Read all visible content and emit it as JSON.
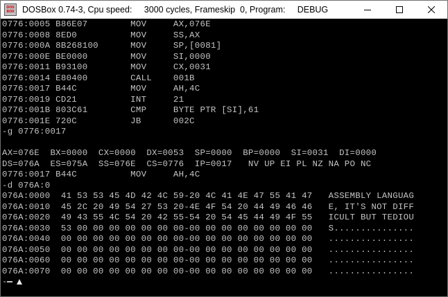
{
  "window": {
    "title": "DOSBox 0.74-3, Cpu speed:     3000 cycles, Frameskip  0, Program:     DEBUG",
    "icon_top": "DOS",
    "icon_bottom": "BOX",
    "buttons": {
      "minimize": "minimize-icon",
      "maximize": "maximize-icon",
      "close": "close-icon"
    }
  },
  "console": {
    "lines": [
      "0776:0005 B86E07        MOV     AX,076E",
      "0776:0008 8ED0          MOV     SS,AX",
      "0776:000A 8B268100      MOV     SP,[0081]",
      "0776:000E BE0000        MOV     SI,0000",
      "0776:0011 B93100        MOV     CX,0031",
      "0776:0014 E80400        CALL    001B",
      "0776:0017 B44C          MOV     AH,4C",
      "0776:0019 CD21          INT     21",
      "0776:001B 803C61        CMP     BYTE PTR [SI],61",
      "0776:001E 720C          JB      002C",
      "-g 0776:0017",
      "",
      "AX=076E  BX=0000  CX=0000  DX=0053  SP=0000  BP=0000  SI=0031  DI=0000",
      "DS=076A  ES=075A  SS=076E  CS=0776  IP=0017   NV UP EI PL NZ NA PO NC",
      "0776:0017 B44C          MOV     AH,4C",
      "-d 076A:0",
      "076A:0000  41 53 53 45 4D 42 4C 59-20 4C 41 4E 47 55 41 47   ASSEMBLY LANGUAG",
      "076A:0010  45 2C 20 49 54 27 53 20-4E 4F 54 20 44 49 46 46   E, IT'S NOT DIFF",
      "076A:0020  49 43 55 4C 54 20 42 55-54 20 54 45 44 49 4F 55   ICULT BUT TEDIOU",
      "076A:0030  53 00 00 00 00 00 00 00-00 00 00 00 00 00 00 00   S...............",
      "076A:0040  00 00 00 00 00 00 00 00-00 00 00 00 00 00 00 00   ................",
      "076A:0050  00 00 00 00 00 00 00 00-00 00 00 00 00 00 00 00   ................",
      "076A:0060  00 00 00 00 00 00 00 00-00 00 00 00 00 00 00 00   ................",
      "076A:0070  00 00 00 00 00 00 00 00-00 00 00 00 00 00 00 00   ................"
    ],
    "prompt": "-",
    "text_color": "#c4c4c4",
    "background": "#000000"
  }
}
